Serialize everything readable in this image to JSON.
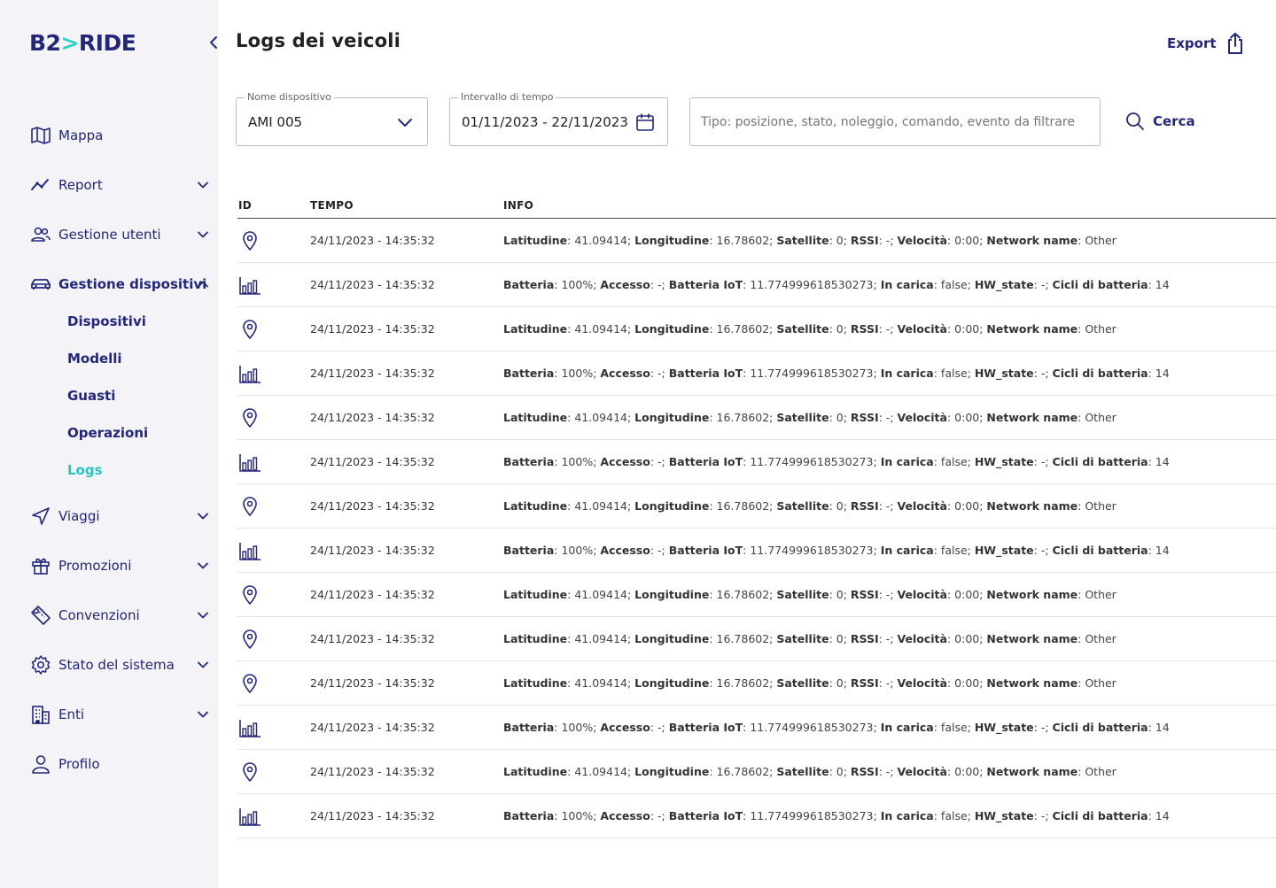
{
  "brand": {
    "logo_left": "B2",
    "logo_chev": ">",
    "logo_right": "RIDE"
  },
  "colors": {
    "primary": "#23277a",
    "accent": "#2bd3c3",
    "sidebar_bg": "#f3f3f8"
  },
  "sidebar": {
    "items": [
      {
        "label": "Mappa",
        "icon": "map-icon",
        "expandable": false
      },
      {
        "label": "Report",
        "icon": "chart-line-icon",
        "expandable": true
      },
      {
        "label": "Gestione utenti",
        "icon": "users-icon",
        "expandable": true
      },
      {
        "label": "Gestione dispositivi",
        "icon": "car-icon",
        "expandable": true,
        "expanded": true
      },
      {
        "label": "Viaggi",
        "icon": "navigation-icon",
        "expandable": true
      },
      {
        "label": "Promozioni",
        "icon": "gift-icon",
        "expandable": true
      },
      {
        "label": "Convenzioni",
        "icon": "ticket-icon",
        "expandable": true
      },
      {
        "label": "Stato del sistema",
        "icon": "gear-icon",
        "expandable": true
      },
      {
        "label": "Enti",
        "icon": "building-icon",
        "expandable": true
      },
      {
        "label": "Profilo",
        "icon": "user-icon",
        "expandable": false
      }
    ],
    "subitems": [
      {
        "label": "Dispositivi"
      },
      {
        "label": "Modelli"
      },
      {
        "label": "Guasti"
      },
      {
        "label": "Operazioni"
      },
      {
        "label": "Logs",
        "current": true
      }
    ]
  },
  "header": {
    "title": "Logs dei veicoli",
    "export_label": "Export"
  },
  "filters": {
    "device": {
      "label": "Nome dispositivo",
      "value": "AMI 005"
    },
    "interval": {
      "label": "Intervallo di tempo",
      "value": "01/11/2023 - 22/11/2023"
    },
    "type": {
      "placeholder": "Tipo: posizione, stato, noleggio, comando, evento da filtrare"
    },
    "search_label": "Cerca"
  },
  "table": {
    "columns": [
      "ID",
      "TEMPO",
      "INFO"
    ],
    "rows": [
      {
        "type": "position",
        "time": "24/11/2023 - 14:35:32"
      },
      {
        "type": "battery",
        "time": "24/11/2023 - 14:35:32"
      },
      {
        "type": "position",
        "time": "24/11/2023 - 14:35:32"
      },
      {
        "type": "battery",
        "time": "24/11/2023 - 14:35:32"
      },
      {
        "type": "position",
        "time": "24/11/2023 - 14:35:32"
      },
      {
        "type": "battery",
        "time": "24/11/2023 - 14:35:32"
      },
      {
        "type": "position",
        "time": "24/11/2023 - 14:35:32"
      },
      {
        "type": "battery",
        "time": "24/11/2023 - 14:35:32"
      },
      {
        "type": "position",
        "time": "24/11/2023 - 14:35:32"
      },
      {
        "type": "position",
        "time": "24/11/2023 - 14:35:32"
      },
      {
        "type": "position",
        "time": "24/11/2023 - 14:35:32"
      },
      {
        "type": "battery",
        "time": "24/11/2023 - 14:35:32"
      },
      {
        "type": "position",
        "time": "24/11/2023 - 14:35:32"
      },
      {
        "type": "battery",
        "time": "24/11/2023 - 14:35:32"
      }
    ],
    "info": {
      "position": [
        {
          "k": "Latitudine",
          "v": ": 41.09414; "
        },
        {
          "k": "Longitudine",
          "v": ": 16.78602; "
        },
        {
          "k": "Satellite",
          "v": ": 0; "
        },
        {
          "k": "RSSI",
          "v": ": -; "
        },
        {
          "k": "Velocità",
          "v": ": 0:00; "
        },
        {
          "k": "Network name",
          "v": ": Other"
        }
      ],
      "battery": [
        {
          "k": "Batteria",
          "v": ": 100%; "
        },
        {
          "k": "Accesso",
          "v": ": -; "
        },
        {
          "k": "Batteria IoT",
          "v": ": 11.774999618530273; "
        },
        {
          "k": "In carica",
          "v": ": false; "
        },
        {
          "k": "HW_state",
          "v": ": -; "
        },
        {
          "k": "Cicli di batteria",
          "v": ": 14"
        }
      ]
    }
  }
}
